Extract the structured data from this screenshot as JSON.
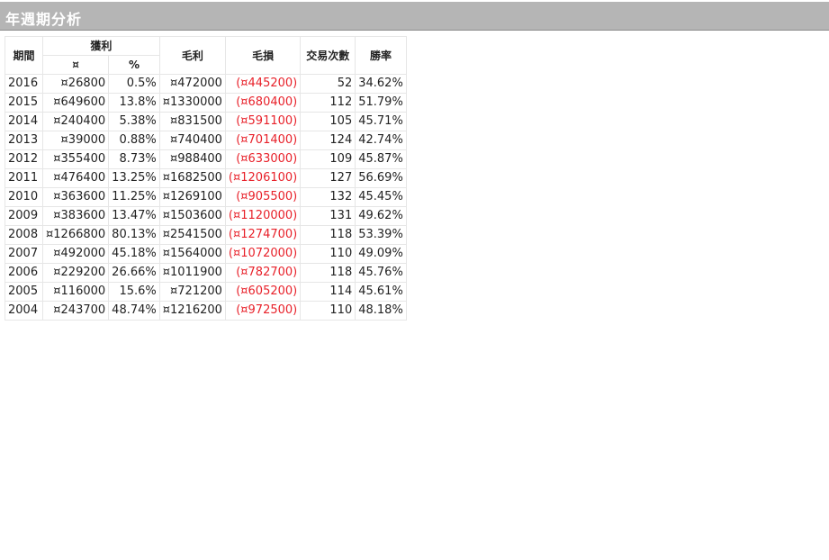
{
  "title": "年週期分析",
  "headers": {
    "period": "期間",
    "profit": "獲利",
    "profit_currency": "¤",
    "profit_percent": "%",
    "gross_profit": "毛利",
    "gross_loss": "毛損",
    "trades": "交易次數",
    "win_rate": "勝率"
  },
  "colors": {
    "title_bar": "#b5b5b5",
    "loss_text": "#e8212a"
  },
  "rows": [
    {
      "year": "2016",
      "profit": "¤26800",
      "profit_pct": "0.5%",
      "gross_profit": "¤472000",
      "gross_loss": "(¤445200)",
      "trades": "52",
      "win_rate": "34.62%"
    },
    {
      "year": "2015",
      "profit": "¤649600",
      "profit_pct": "13.8%",
      "gross_profit": "¤1330000",
      "gross_loss": "(¤680400)",
      "trades": "112",
      "win_rate": "51.79%"
    },
    {
      "year": "2014",
      "profit": "¤240400",
      "profit_pct": "5.38%",
      "gross_profit": "¤831500",
      "gross_loss": "(¤591100)",
      "trades": "105",
      "win_rate": "45.71%"
    },
    {
      "year": "2013",
      "profit": "¤39000",
      "profit_pct": "0.88%",
      "gross_profit": "¤740400",
      "gross_loss": "(¤701400)",
      "trades": "124",
      "win_rate": "42.74%"
    },
    {
      "year": "2012",
      "profit": "¤355400",
      "profit_pct": "8.73%",
      "gross_profit": "¤988400",
      "gross_loss": "(¤633000)",
      "trades": "109",
      "win_rate": "45.87%"
    },
    {
      "year": "2011",
      "profit": "¤476400",
      "profit_pct": "13.25%",
      "gross_profit": "¤1682500",
      "gross_loss": "(¤1206100)",
      "trades": "127",
      "win_rate": "56.69%"
    },
    {
      "year": "2010",
      "profit": "¤363600",
      "profit_pct": "11.25%",
      "gross_profit": "¤1269100",
      "gross_loss": "(¤905500)",
      "trades": "132",
      "win_rate": "45.45%"
    },
    {
      "year": "2009",
      "profit": "¤383600",
      "profit_pct": "13.47%",
      "gross_profit": "¤1503600",
      "gross_loss": "(¤1120000)",
      "trades": "131",
      "win_rate": "49.62%"
    },
    {
      "year": "2008",
      "profit": "¤1266800",
      "profit_pct": "80.13%",
      "gross_profit": "¤2541500",
      "gross_loss": "(¤1274700)",
      "trades": "118",
      "win_rate": "53.39%"
    },
    {
      "year": "2007",
      "profit": "¤492000",
      "profit_pct": "45.18%",
      "gross_profit": "¤1564000",
      "gross_loss": "(¤1072000)",
      "trades": "110",
      "win_rate": "49.09%"
    },
    {
      "year": "2006",
      "profit": "¤229200",
      "profit_pct": "26.66%",
      "gross_profit": "¤1011900",
      "gross_loss": "(¤782700)",
      "trades": "118",
      "win_rate": "45.76%"
    },
    {
      "year": "2005",
      "profit": "¤116000",
      "profit_pct": "15.6%",
      "gross_profit": "¤721200",
      "gross_loss": "(¤605200)",
      "trades": "114",
      "win_rate": "45.61%"
    },
    {
      "year": "2004",
      "profit": "¤243700",
      "profit_pct": "48.74%",
      "gross_profit": "¤1216200",
      "gross_loss": "(¤972500)",
      "trades": "110",
      "win_rate": "48.18%"
    }
  ]
}
